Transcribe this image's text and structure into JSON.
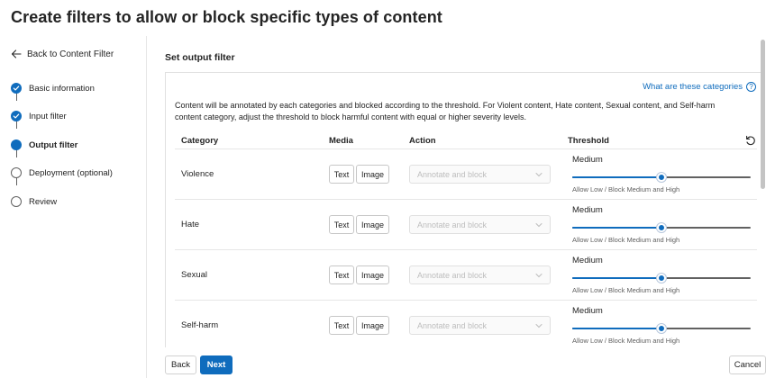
{
  "page": {
    "title": "Create filters to allow or block specific types of content"
  },
  "nav": {
    "back_label": "Back to Content Filter",
    "steps": [
      {
        "label": "Basic information",
        "state": "done"
      },
      {
        "label": "Input filter",
        "state": "done"
      },
      {
        "label": "Output filter",
        "state": "current"
      },
      {
        "label": "Deployment (optional)",
        "state": "todo"
      },
      {
        "label": "Review",
        "state": "todo"
      }
    ]
  },
  "section": {
    "title": "Set output filter",
    "help_link": "What are these categories",
    "description": "Content will be annotated by each categories and blocked according to the threshold. For Violent content, Hate content, Sexual content, and Self-harm content category, adjust the threshold to block harmful content with equal or higher severity levels."
  },
  "table": {
    "headers": {
      "category": "Category",
      "media": "Media",
      "action": "Action",
      "threshold": "Threshold"
    },
    "rows": [
      {
        "category": "Violence",
        "media_text": "Text",
        "media_image": "Image",
        "action": "Annotate and block",
        "threshold_label": "Medium",
        "threshold_value": 0.5,
        "hint": "Allow Low / Block Medium and High"
      },
      {
        "category": "Hate",
        "media_text": "Text",
        "media_image": "Image",
        "action": "Annotate and block",
        "threshold_label": "Medium",
        "threshold_value": 0.5,
        "hint": "Allow Low / Block Medium and High"
      },
      {
        "category": "Sexual",
        "media_text": "Text",
        "media_image": "Image",
        "action": "Annotate and block",
        "threshold_label": "Medium",
        "threshold_value": 0.5,
        "hint": "Allow Low / Block Medium and High"
      },
      {
        "category": "Self-harm",
        "media_text": "Text",
        "media_image": "Image",
        "action": "Annotate and block",
        "threshold_label": "Medium",
        "threshold_value": 0.5,
        "hint": "Allow Low / Block Medium and High"
      }
    ]
  },
  "footer": {
    "back": "Back",
    "next": "Next",
    "cancel": "Cancel"
  },
  "colors": {
    "accent": "#0f6cbd",
    "text": "#242424",
    "muted": "#616161",
    "disabled_text": "#bdbdbd"
  },
  "icons": {
    "back": "arrow-left-icon",
    "help": "question-circle-icon",
    "reset": "reset-icon",
    "dropdown": "chevron-down-icon",
    "step_done": "check-circle-icon"
  }
}
